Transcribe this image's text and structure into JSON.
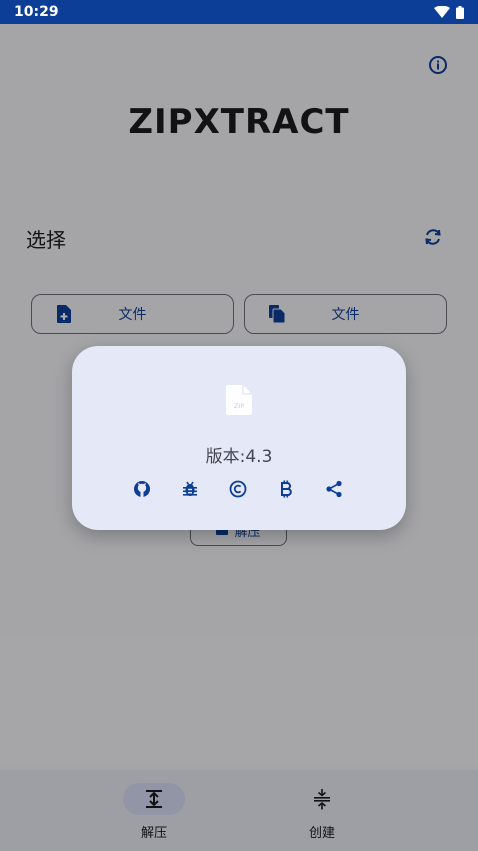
{
  "status_bar": {
    "time": "10:29"
  },
  "app": {
    "title": "ZIPXTRACT"
  },
  "select_section": {
    "label": "选择",
    "file_button_1": "文件",
    "file_button_2": "文件",
    "extract_button": "解压"
  },
  "bottom_nav": {
    "items": [
      {
        "label": "解压",
        "icon": "extract-icon",
        "selected": true
      },
      {
        "label": "创建",
        "icon": "create-icon",
        "selected": false
      }
    ]
  },
  "about_dialog": {
    "icon": "zip-file-icon",
    "icon_text": "ZIP",
    "version_label": "版本:",
    "version_value": "4.3",
    "actions": [
      "github-icon",
      "bug-icon",
      "copyright-icon",
      "bitcoin-icon",
      "share-icon"
    ]
  },
  "colors": {
    "status_bar": "#0d3e97",
    "accent": "#0d3e97",
    "dialog_bg": "#e4e8f7",
    "nav_bg": "#e9eaf3",
    "nav_selected_pill": "#d6dcf5"
  }
}
